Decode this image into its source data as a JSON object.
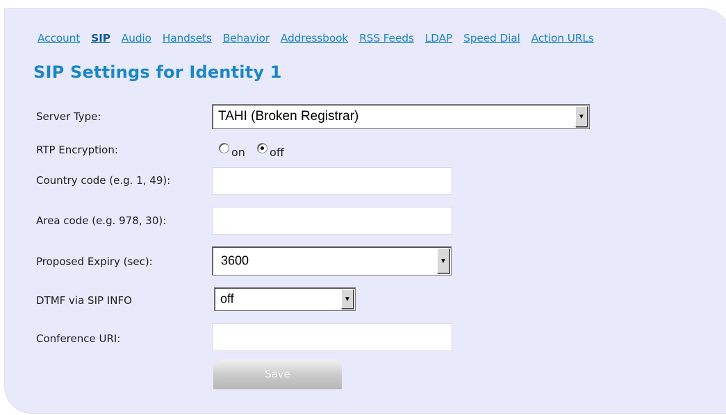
{
  "nav": {
    "items": [
      {
        "label": "Account"
      },
      {
        "label": "SIP",
        "active": true
      },
      {
        "label": "Audio"
      },
      {
        "label": "Handsets"
      },
      {
        "label": "Behavior"
      },
      {
        "label": "Addressbook"
      },
      {
        "label": "RSS Feeds"
      },
      {
        "label": "LDAP"
      },
      {
        "label": "Speed Dial"
      },
      {
        "label": "Action URLs"
      }
    ]
  },
  "page": {
    "title": "SIP Settings for Identity 1"
  },
  "form": {
    "server_type": {
      "label": "Server Type:",
      "value": "TAHI (Broken Registrar)"
    },
    "rtp_encryption": {
      "label": "RTP Encryption:",
      "on_label": "on",
      "off_label": "off",
      "selected": "off"
    },
    "country_code": {
      "label": "Country code (e.g. 1, 49):",
      "value": ""
    },
    "area_code": {
      "label": "Area code (e.g. 978, 30):",
      "value": ""
    },
    "proposed_expiry": {
      "label": "Proposed Expiry (sec):",
      "value": "3600"
    },
    "dtmf": {
      "label": "DTMF via SIP INFO",
      "value": "off"
    },
    "conference_uri": {
      "label": "Conference URI:",
      "value": ""
    },
    "save_label": "Save"
  },
  "colors": {
    "panel_bg": "#e8e9fb",
    "link": "#1b86c4",
    "title": "#1b86c4"
  },
  "icons": {
    "dropdown": "chevron-down-icon"
  }
}
